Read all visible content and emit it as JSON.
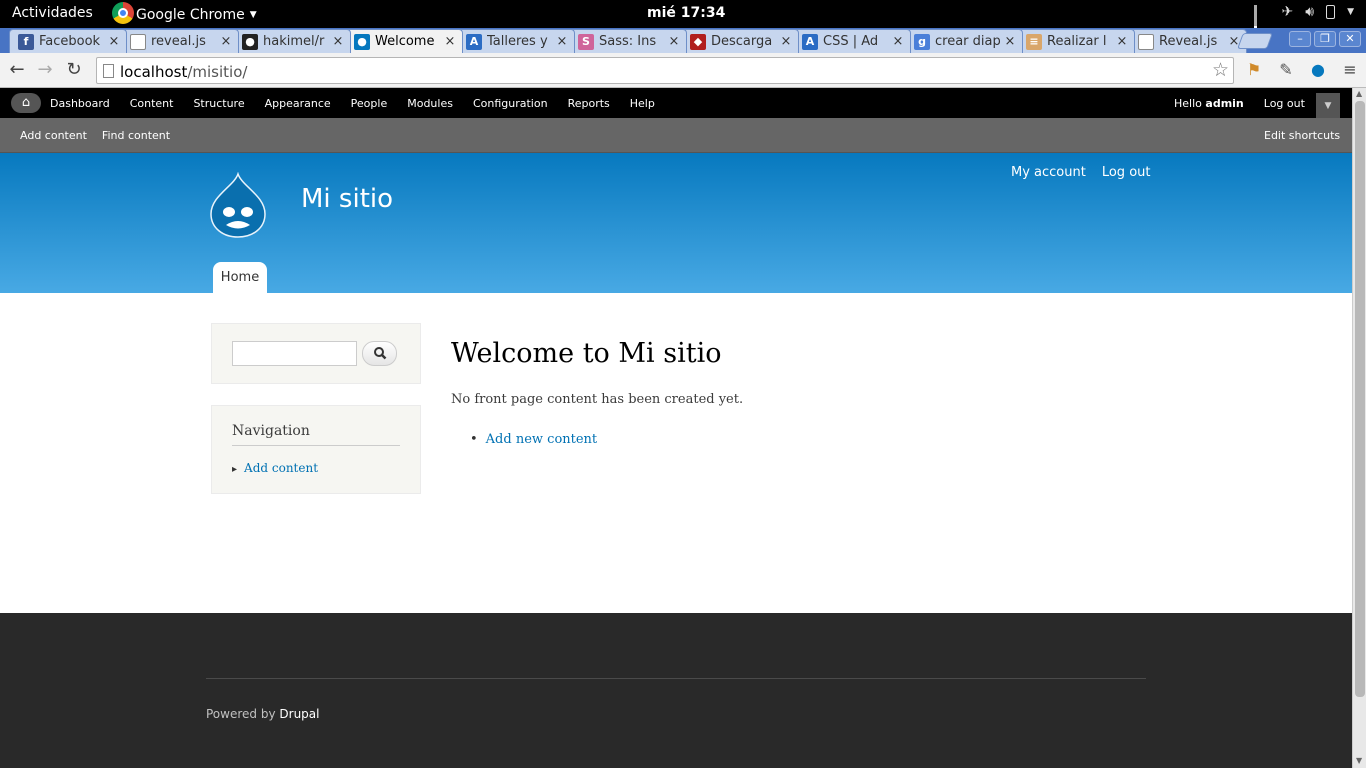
{
  "system_bar": {
    "activities": "Actividades",
    "app_name": "Google Chrome",
    "clock": "mié 17:34"
  },
  "browser": {
    "tabs": [
      {
        "title": "Facebook",
        "icon": "facebook-icon",
        "color": "#3b5998",
        "glyph": "f",
        "active": false
      },
      {
        "title": "reveal.js",
        "icon": "page-icon",
        "color": "#ffffff",
        "glyph": "",
        "active": false
      },
      {
        "title": "hakimel/r",
        "icon": "github-icon",
        "color": "#222222",
        "glyph": "●",
        "active": false
      },
      {
        "title": "Welcome",
        "icon": "drupal-icon",
        "color": "#0678be",
        "glyph": "●",
        "active": true
      },
      {
        "title": "Talleres y",
        "icon": "aprenderaprogramar-icon",
        "color": "#2b6cc4",
        "glyph": "A",
        "active": false
      },
      {
        "title": "Sass: Ins",
        "icon": "sass-icon",
        "color": "#cf649a",
        "glyph": "S",
        "active": false
      },
      {
        "title": "Descarga",
        "icon": "ruby-icon",
        "color": "#b11e1e",
        "glyph": "◆",
        "active": false
      },
      {
        "title": "CSS | Ad",
        "icon": "aprenderaprogramar-icon",
        "color": "#2b6cc4",
        "glyph": "A",
        "active": false
      },
      {
        "title": "crear diap",
        "icon": "google-icon",
        "color": "#4a7fd9",
        "glyph": "g",
        "active": false
      },
      {
        "title": "Realizar l",
        "icon": "site-icon",
        "color": "#d9a66a",
        "glyph": "≡",
        "active": false
      },
      {
        "title": "Reveal.js",
        "icon": "page-icon",
        "color": "#ffffff",
        "glyph": "",
        "active": false
      }
    ],
    "url_host": "localhost",
    "url_path": "/misitio/"
  },
  "admin_toolbar": {
    "menu": [
      "Dashboard",
      "Content",
      "Structure",
      "Appearance",
      "People",
      "Modules",
      "Configuration",
      "Reports",
      "Help"
    ],
    "hello": "Hello",
    "user": "admin",
    "logout": "Log out"
  },
  "shortcuts": {
    "items": [
      "Add content",
      "Find content"
    ],
    "edit": "Edit shortcuts"
  },
  "header": {
    "site_name": "Mi sitio",
    "secondary_menu": [
      "My account",
      "Log out"
    ],
    "main_menu_home": "Home"
  },
  "sidebar": {
    "navigation_title": "Navigation",
    "navigation_links": [
      "Add content"
    ]
  },
  "main": {
    "title": "Welcome to Mi sitio",
    "intro": "No front page content has been created yet.",
    "add_link": "Add new content"
  },
  "footer": {
    "powered_by": "Powered by",
    "drupal": "Drupal"
  },
  "colors": {
    "header_top": "#0779bf",
    "header_bottom": "#48a9e4",
    "link": "#0071b3",
    "footer_bg": "#292929"
  }
}
